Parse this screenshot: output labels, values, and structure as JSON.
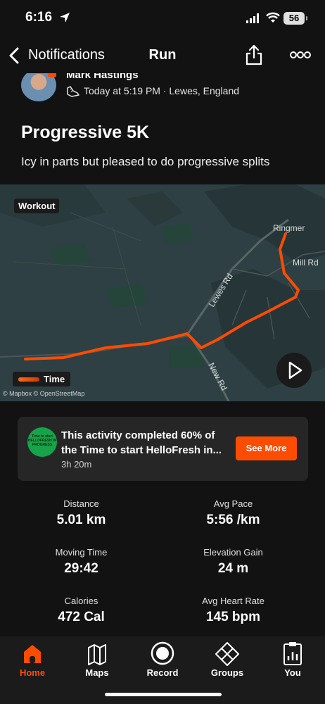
{
  "status_bar": {
    "time": "6:16",
    "battery": "56"
  },
  "navbar": {
    "back_label": "Notifications",
    "title": "Run"
  },
  "activity": {
    "athlete": "Mark Hastings",
    "meta": "Today at 5:19 PM · Lewes, England",
    "title": "Progressive 5K",
    "description": "Icy in parts but pleased to do progressive splits"
  },
  "map": {
    "workout_tag": "Workout",
    "places": {
      "ringmer": "Ringmer",
      "mill_rd": "Mill Rd",
      "lewes_rd": "Lewes Rd",
      "new_rd": "New Rd"
    },
    "legend": "Time",
    "attribution": "© Mapbox © OpenStreetMap",
    "route_color": "#fc4c02"
  },
  "promo": {
    "logo_text": "Time to start HELLOFRESH IN PROGRESS",
    "text": "This activity completed 60% of the Time to start HelloFresh in...",
    "time": "3h 20m",
    "button": "See More",
    "progress_percent": 60
  },
  "stats": [
    {
      "label": "Distance",
      "value": "5.01 km"
    },
    {
      "label": "Avg Pace",
      "value": "5:56 /km"
    },
    {
      "label": "Moving Time",
      "value": "29:42"
    },
    {
      "label": "Elevation Gain",
      "value": "24 m"
    },
    {
      "label": "Calories",
      "value": "472 Cal"
    },
    {
      "label": "Avg Heart Rate",
      "value": "145 bpm"
    }
  ],
  "tabs": [
    {
      "label": "Home",
      "icon": "home-icon",
      "active": true
    },
    {
      "label": "Maps",
      "icon": "map-icon"
    },
    {
      "label": "Record",
      "icon": "record-icon"
    },
    {
      "label": "Groups",
      "icon": "groups-icon"
    },
    {
      "label": "You",
      "icon": "you-icon"
    }
  ],
  "colors": {
    "accent": "#fc4c02",
    "background": "#121212",
    "card": "#262626"
  }
}
